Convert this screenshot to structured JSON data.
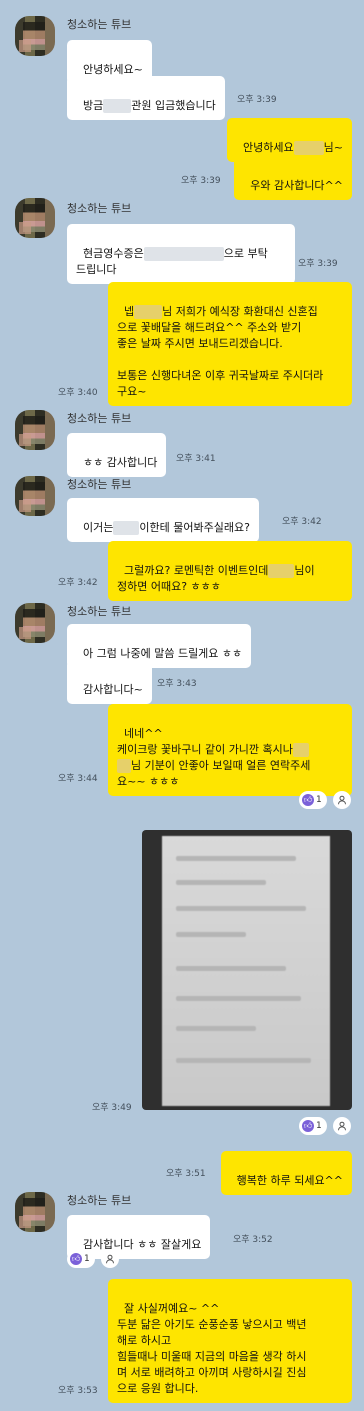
{
  "sender_name": "청소하는 튜브",
  "messages": {
    "m1": "안녕하세요~",
    "m2a": "방금",
    "m2b": "관원 입금했습니다",
    "m3a": "안녕하세요",
    "m3b": "님~",
    "m4": "우와 감사합니다^^",
    "m5a": "현금영수증은",
    "m5b": "으로 부탁",
    "m5c": "드립니다",
    "m6a": "넵",
    "m6b": "님 저희가 예식장 화환대신 신혼집",
    "m6c": "으로 꽃배달을 해드려요^^ 주소와 받기",
    "m6d": "좋은 날짜 주시면 보내드리겠습니다.",
    "m6e": "보통은 신행다녀온 이후 귀국날짜로 주시더라",
    "m6f": "구요~",
    "m7": "ㅎㅎ 감사합니다",
    "m8a": "이거는",
    "m8b": "이한테 물어봐주실래요?",
    "m9a": "그럴까요? 로멘틱한 이벤트인데",
    "m9b": "님이",
    "m9c": "정하면 어때요? ㅎㅎㅎ",
    "m10": "아 그럼 나중에 말씀 드릴게요 ㅎㅎ",
    "m11": "감사합니다~",
    "m12a": "네네^^",
    "m12b": "케이크랑 꽃바구니 같이 가니깐 혹시나",
    "m12c": "님 기분이 안좋아 보일때 얼른 연락주세",
    "m12d": "요~~ ㅎㅎㅎ",
    "m13": "행복한 하루 되세요^^",
    "m14": "감사합니다 ㅎㅎ 잘살게요",
    "m15a": "잘 사실꺼예요~ ^^",
    "m15b": "두분 닮은 아기도 순풍순풍 낳으시고 백년",
    "m15c": "해로 하시고",
    "m15d": "힘들때나 미울때 지금의 마음을 생각 하시",
    "m15e": "며 서로 배려하고 아끼며 사랑하시길 진심",
    "m15f": "으로 응원 합니다."
  },
  "times": {
    "t339": "오후 3:39",
    "t340": "오후 3:40",
    "t341": "오후 3:41",
    "t342": "오후 3:42",
    "t343": "오후 3:43",
    "t344": "오후 3:44",
    "t349": "오후 3:49",
    "t351": "오후 3:51",
    "t352": "오후 3:52",
    "t353": "오후 3:53"
  },
  "reactions": {
    "like_count": "1"
  },
  "icons": {
    "like": "thumbs-up-icon",
    "person": "person-icon"
  },
  "colors": {
    "background": "#b2c7da",
    "my_bubble": "#fee500",
    "their_bubble": "#ffffff",
    "like": "#7b61d9"
  }
}
